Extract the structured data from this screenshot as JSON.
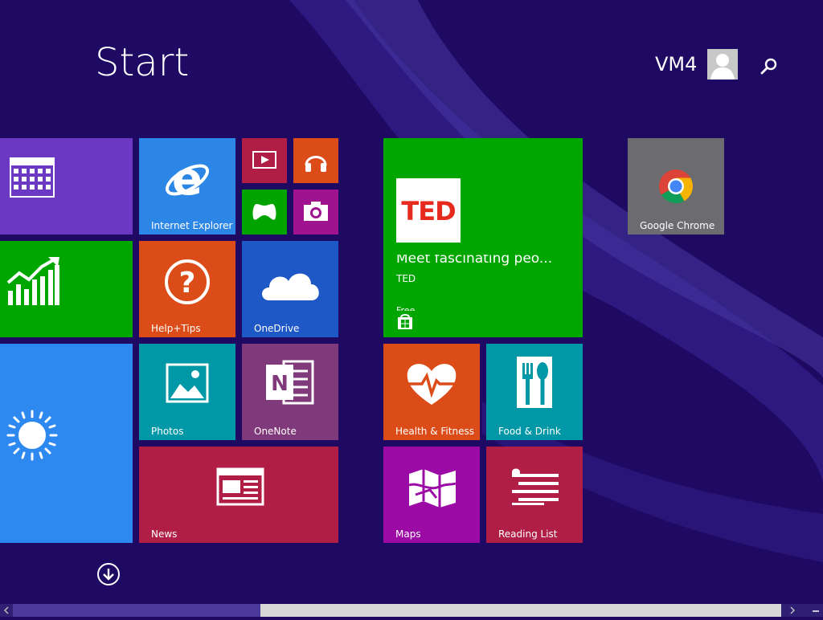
{
  "header": {
    "title": "Start",
    "user_name": "VM4"
  },
  "colors": {
    "background": "#1e0a63",
    "calendar": "#6a38c2",
    "finance": "#00a600",
    "weather": "#2d89ef",
    "internet_explorer": "#2c86e6",
    "video": "#b01e45",
    "music": "#dc4c19",
    "games": "#00a300",
    "camera": "#a0138e",
    "help_tips": "#dc4c19",
    "onedrive": "#1e58c6",
    "photos": "#0097a7",
    "onenote": "#80397b",
    "news": "#b01e45",
    "ted": "#00a600",
    "health_fitness": "#dc4c19",
    "food_drink": "#0097a7",
    "maps": "#9c0aa6",
    "reading_list": "#b01e45",
    "google_chrome": "#6b6b70"
  },
  "tiles": {
    "internet_explorer": "Internet Explorer",
    "help_tips": "Help+Tips",
    "onedrive": "OneDrive",
    "photos": "Photos",
    "onenote": "OneNote",
    "news": "News",
    "health_fitness": "Health & Fitness",
    "food_drink": "Food & Drink",
    "maps": "Maps",
    "reading_list": "Reading List",
    "google_chrome": "Google Chrome"
  },
  "ted": {
    "logo": "TED",
    "headline": "Meet fascinating peo...",
    "publisher": "TED",
    "price": "Free"
  },
  "icons": {
    "calendar": "calendar-icon",
    "finance": "chart-icon",
    "weather": "sun-icon",
    "search": "search-icon",
    "avatar": "user-avatar-icon",
    "all_apps": "down-arrow-icon"
  }
}
